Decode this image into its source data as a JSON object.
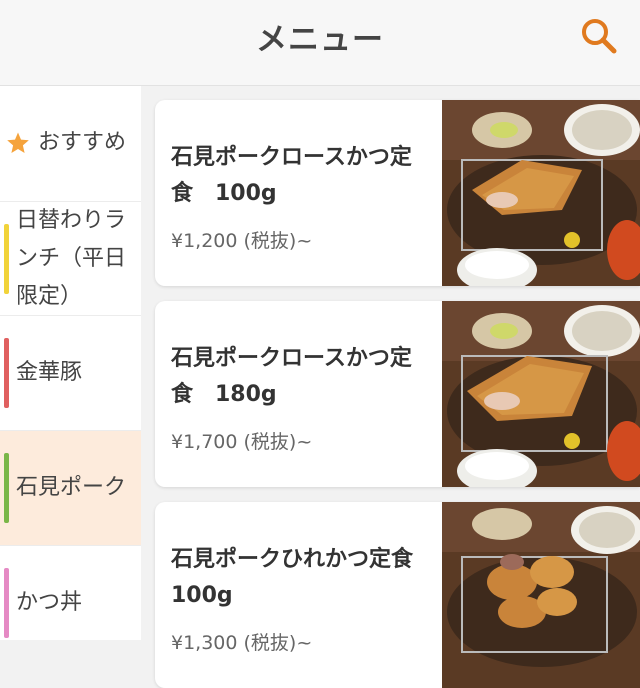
{
  "header": {
    "title": "メニュー",
    "search_icon": "search-icon"
  },
  "sidebar": {
    "items": [
      {
        "label": "おすすめ",
        "icon": "star-icon",
        "icon_color": "#f5a33c"
      },
      {
        "label": "日替わりランチ（平日限定）",
        "bar_color": "#f1d33a"
      },
      {
        "label": "金華豚",
        "bar_color": "#e06060"
      },
      {
        "label": "石見ポーク",
        "bar_color": "#7ab648",
        "active": true
      },
      {
        "label": "かつ丼",
        "bar_color": "#e58ac4"
      }
    ]
  },
  "menu": {
    "items": [
      {
        "name": "石見ポークロースかつ定食　100g",
        "price": "¥1,200 (税抜)~"
      },
      {
        "name": "石見ポークロースかつ定食　180g",
        "price": "¥1,700 (税抜)~"
      },
      {
        "name": "石見ポークひれかつ定食　100g",
        "price": "¥1,300 (税抜)~"
      }
    ]
  },
  "colors": {
    "accent": "#e07a1f",
    "active_bg": "#fdebdc"
  }
}
